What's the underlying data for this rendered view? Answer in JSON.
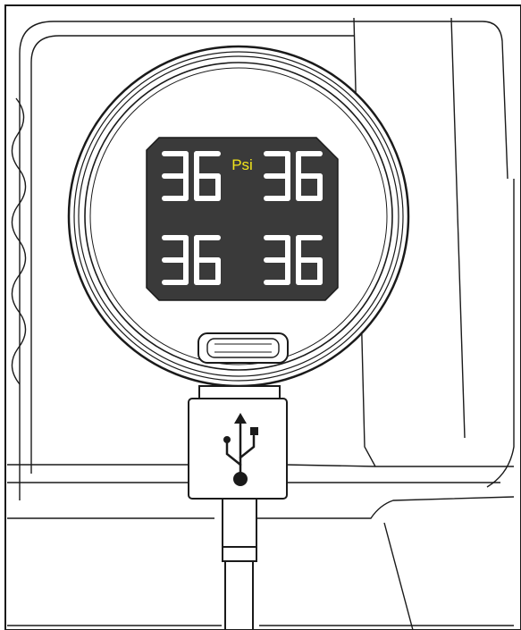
{
  "display": {
    "unit": "Psi",
    "readings": {
      "front_left": "36",
      "front_right": "36",
      "rear_left": "36",
      "rear_right": "36"
    },
    "unit_color": "#f2e51b",
    "digit_color": "#ffffff",
    "screen_color": "#3a3a3a"
  },
  "icons": {
    "connector": "usb-icon"
  }
}
